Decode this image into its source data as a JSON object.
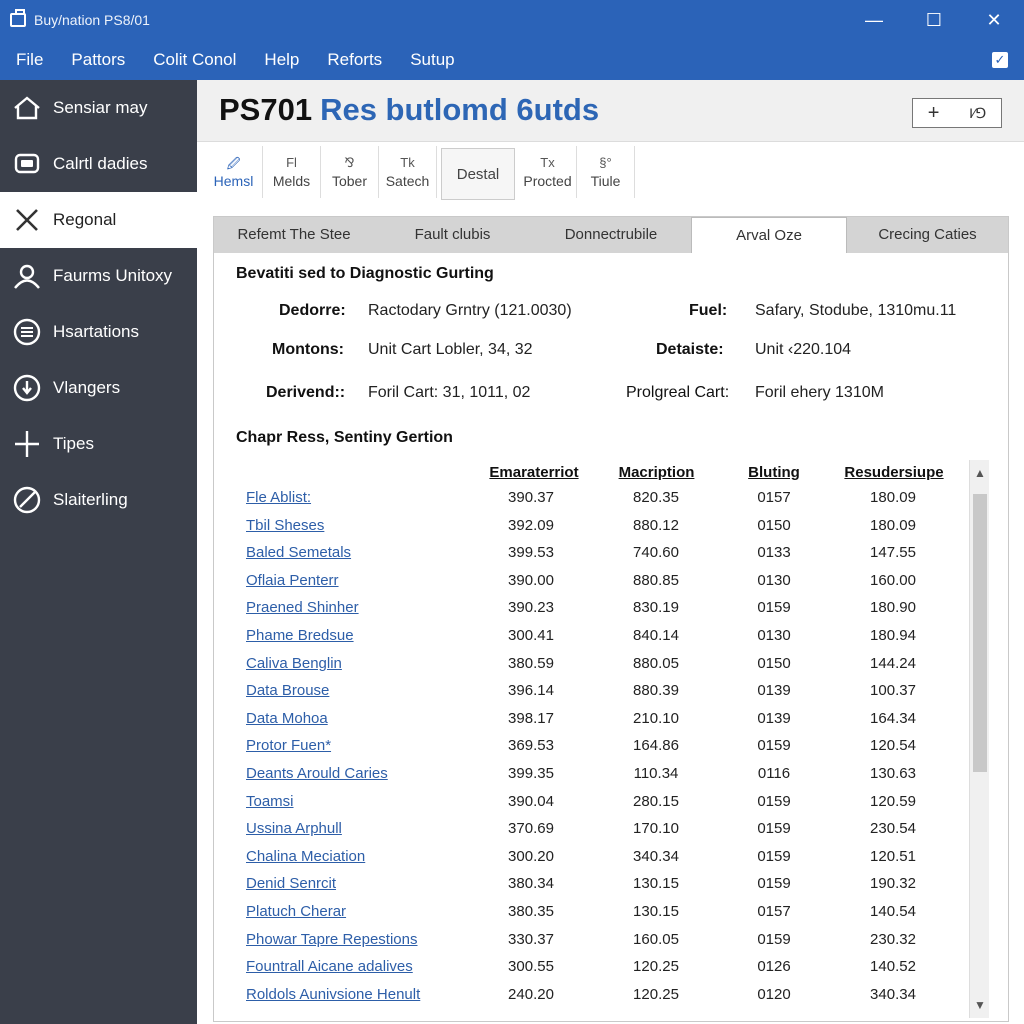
{
  "window": {
    "title": "Buy/nation PS8/01",
    "controls": [
      "—",
      "☐",
      "✕"
    ]
  },
  "menu": [
    "File",
    "Pattors",
    "Colit Conol",
    "Help",
    "Reforts",
    "Sutup"
  ],
  "sidebar": {
    "items": [
      {
        "label": "Sensiar may",
        "icon": "home-icon"
      },
      {
        "label": "Calrtl dadies",
        "icon": "chat-icon"
      },
      {
        "label": "Regonal",
        "icon": "close-icon",
        "active": true
      },
      {
        "label": "Faurms Unitoxy",
        "icon": "user-icon"
      },
      {
        "label": "Hsartations",
        "icon": "list-icon"
      },
      {
        "label": "Vlangers",
        "icon": "info-icon"
      },
      {
        "label": "Tipes",
        "icon": "cross-icon"
      },
      {
        "label": "Slaiterling",
        "icon": "slash-circle-icon"
      }
    ]
  },
  "header": {
    "title_main": "PS701",
    "title_accent": "Res butlomd 6utds",
    "button_plus": "+",
    "button_secondary": "I⁄⅁"
  },
  "toolbar": [
    {
      "glyph": "🖉",
      "label": "Hemsl"
    },
    {
      "glyph": "Fl",
      "label": "Melds"
    },
    {
      "glyph": "⅋",
      "label": "Tober"
    },
    {
      "glyph": "Tk",
      "label": "Satech"
    },
    {
      "glyph": "",
      "label": "Destal"
    },
    {
      "glyph": "Tx",
      "label": "Procted"
    },
    {
      "glyph": "§°",
      "label": "Tiule"
    }
  ],
  "tabs": [
    "Refemt The Stee",
    "Fault clubis",
    "Donnectrubile",
    "Arval Oze",
    "Crecing Caties"
  ],
  "active_tab": 3,
  "section1": {
    "title": "Bevatiti sed to Diagnostic Gurting",
    "fields": [
      {
        "key": "Dedorre:",
        "value": "Ractodary Grntry (121.0030)"
      },
      {
        "key": "Fuel:",
        "value": "Safary, Stodube, 1310mu.11"
      },
      {
        "key": "Montons:",
        "value": "Unit Cart Lobler, 34, 32"
      },
      {
        "key": "Detaiste:",
        "value": "Unit ‹220.104"
      },
      {
        "key": "Derivend::",
        "value": "Foril Cart: 31, 1011, 02"
      },
      {
        "key": "Prolgreal Cart:",
        "value": "Foril ehery 1310M"
      }
    ]
  },
  "section2": {
    "title": "Chapr Ress, Sentiny Gertion",
    "columns": [
      "Emaraterriot",
      "Macription",
      "Bluting",
      "Resudersiupe"
    ],
    "rows": [
      {
        "name": "Fle Ablist:",
        "c1": "390.37",
        "c2": "820.35",
        "c3": "0157",
        "c4": "180.09"
      },
      {
        "name": "Tbil Sheses",
        "c1": "392.09",
        "c2": "880.12",
        "c3": "0150",
        "c4": "180.09"
      },
      {
        "name": "Baled Semetals",
        "c1": "399.53",
        "c2": "740.60",
        "c3": "0133",
        "c4": "147.55"
      },
      {
        "name": "Oflaia Penterr",
        "c1": "390.00",
        "c2": "880.85",
        "c3": "0130",
        "c4": "160.00"
      },
      {
        "name": "Praened Shinher",
        "c1": "390.23",
        "c2": "830.19",
        "c3": "0159",
        "c4": "180.90"
      },
      {
        "name": "Phame Bredsue",
        "c1": "300.41",
        "c2": "840.14",
        "c3": "0130",
        "c4": "180.94"
      },
      {
        "name": "Caliva Benglin",
        "c1": "380.59",
        "c2": "880.05",
        "c3": "0150",
        "c4": "144.24"
      },
      {
        "name": "Data Brouse",
        "c1": "396.14",
        "c2": "880.39",
        "c3": "0139",
        "c4": "100.37"
      },
      {
        "name": "Data Mohoa",
        "c1": "398.17",
        "c2": "210.10",
        "c3": "0139",
        "c4": "164.34"
      },
      {
        "name": "Protor Fuen*",
        "c1": "369.53",
        "c2": "164.86",
        "c3": "0159",
        "c4": "120.54"
      },
      {
        "name": "Deants Arould Caries",
        "c1": "399.35",
        "c2": "110.34",
        "c3": "0116",
        "c4": "130.63"
      },
      {
        "name": "Toamsi",
        "c1": "390.04",
        "c2": "280.15",
        "c3": "0159",
        "c4": "120.59"
      },
      {
        "name": "Ussina Arphull",
        "c1": "370.69",
        "c2": "170.10",
        "c3": "0159",
        "c4": "230.54"
      },
      {
        "name": "Chalina Meciation",
        "c1": "300.20",
        "c2": "340.34",
        "c3": "0159",
        "c4": "120.51"
      },
      {
        "name": "Denid Senrcit",
        "c1": "380.34",
        "c2": "130.15",
        "c3": "0159",
        "c4": "190.32"
      },
      {
        "name": "Platuch Cherar",
        "c1": "380.35",
        "c2": "130.15",
        "c3": "0157",
        "c4": "140.54"
      },
      {
        "name": "Phowar Tapre Repestions",
        "c1": "330.37",
        "c2": "160.05",
        "c3": "0159",
        "c4": "230.32"
      },
      {
        "name": "Fountrall Aicane adalives",
        "c1": "300.55",
        "c2": "120.25",
        "c3": "0126",
        "c4": "140.52"
      },
      {
        "name": "Roldols Aunivsione Henult",
        "c1": "240.20",
        "c2": "120.25",
        "c3": "0120",
        "c4": "340.34"
      }
    ]
  },
  "colors": {
    "accent": "#2b63b8",
    "sidebar": "#3a3f4a",
    "link": "#2d5ea8"
  }
}
